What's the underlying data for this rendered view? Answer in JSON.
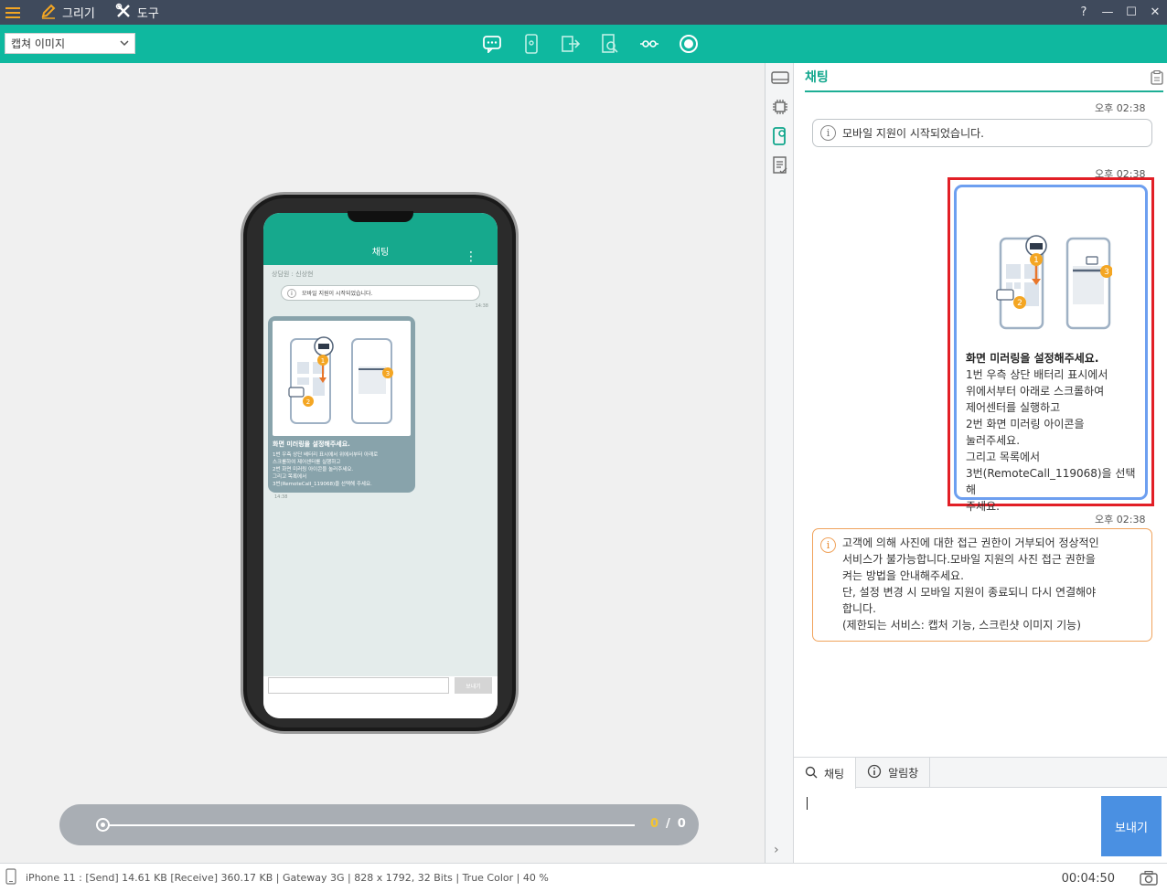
{
  "titlebar": {
    "menu": [
      {
        "label": "그리기",
        "icon": "pencil-icon"
      },
      {
        "label": "도구",
        "icon": "tools-icon"
      }
    ],
    "help": "?",
    "minimize": "—",
    "maximize": "☐",
    "close": "✕"
  },
  "toolbar": {
    "capture_select": "캡쳐 이미지",
    "icons": [
      "chat-icon",
      "phone-icon",
      "exit-icon",
      "magnify-icon",
      "link-icon",
      "record-icon"
    ]
  },
  "phone": {
    "header_title": "채팅",
    "agent_line": "상담원 : 신상현",
    "notice": "모바일 지원이 시작되었습니다.",
    "time1": "14:38",
    "bubble_title": "화면 미러링을 설정해주세요.",
    "bubble_lines": [
      "1번 우측 상단 배터리 표시에서 위에서부터 아래로",
      "스크롤하여 제어센터를 실행하고",
      "2번 화면 미러링 아이콘을 눌러주세요.",
      "그리고 목록에서",
      "3번(RemoteCall_119068)을 선택해 주세요."
    ],
    "time2": "14:38",
    "send_label": "보내기"
  },
  "playbar": {
    "current": "0",
    "separator": "/",
    "total": "0"
  },
  "sidetabs": [
    "drive-icon",
    "chip-icon",
    "mobile-support-icon",
    "checklist-icon"
  ],
  "chat": {
    "title": "채팅",
    "messages": {
      "ts1": "오후 02:38",
      "notice": "모바일 지원이 시작되었습니다.",
      "ts2": "오후 02:38",
      "bubble_title": "화면 미러링을 설정해주세요.",
      "bubble_lines": [
        "1번 우측 상단 배터리 표시에서",
        "위에서부터 아래로 스크롤하여",
        "제어센터를 실행하고",
        "2번 화면 미러링 아이콘을",
        "눌러주세요.",
        "그리고 목록에서",
        "3번(RemoteCall_119068)을 선택해",
        "주세요."
      ],
      "ts3": "오후 02:38",
      "warn_lines": [
        "고객에 의해 사진에 대한 접근 권한이 거부되어 정상적인",
        "서비스가 불가능합니다.모바일 지원의 사진 접근 권한을",
        "켜는 방법을 안내해주세요.",
        "단, 설정 변경 시 모바일 지원이 종료되니 다시 연결해야",
        "합니다.",
        "(제한되는 서비스: 캡처 기능, 스크린샷 이미지 기능)"
      ]
    },
    "tabs": [
      {
        "label": "채팅",
        "icon": "search-icon",
        "active": true
      },
      {
        "label": "알림창",
        "icon": "info-icon",
        "active": false
      }
    ],
    "send_label": "보내기"
  },
  "statusbar": {
    "device_info": "iPhone 11 : [Send] 14.61 KB  [Receive] 360.17 KB | Gateway 3G | 828 x 1792, 32 Bits | True Color | 40 %",
    "timer": "00:04:50"
  },
  "colors": {
    "accent": "#0fb89f",
    "titlebar": "#3f4a5c",
    "highlight": "#e21f26",
    "bubble_border": "#6d9ff0",
    "warn_border": "#f0a35c",
    "send": "#4a90e2"
  }
}
